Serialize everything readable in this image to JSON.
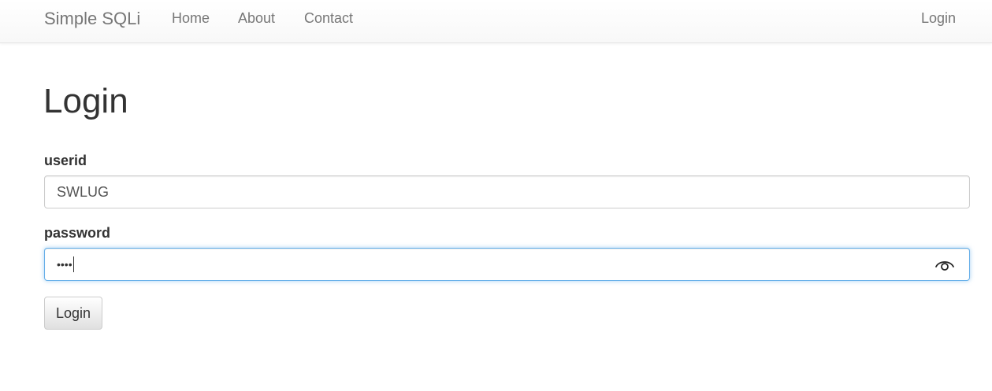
{
  "navbar": {
    "brand": "Simple SQLi",
    "links": [
      "Home",
      "About",
      "Contact"
    ],
    "login_link": "Login"
  },
  "page": {
    "title": "Login"
  },
  "form": {
    "userid_label": "userid",
    "userid_value": "SWLUG",
    "password_label": "password",
    "password_masked": "••••",
    "password_toggle_icon": "eye-icon",
    "submit_label": "Login"
  },
  "colors": {
    "focus_border": "#66afe9",
    "nav_text": "#777777"
  }
}
